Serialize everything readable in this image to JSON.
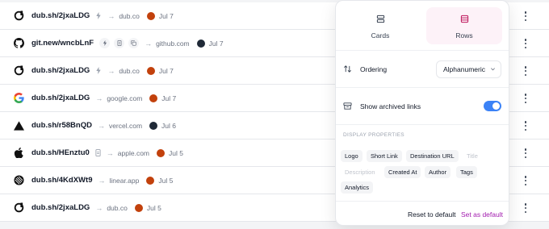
{
  "links": [
    {
      "logo": "dub-logo-icon",
      "short_link": "dub.sh/2jxaLDG",
      "chips": [
        "bolt-icon"
      ],
      "destination": "dub.co",
      "date": "Jul 7",
      "avatar_color": "#c2410c"
    },
    {
      "logo": "github-logo-icon",
      "short_link": "git.new/wncbLnF",
      "chips": [
        "bolt-icon",
        "file-icon",
        "copy-icon"
      ],
      "destination": "github.com",
      "date": "Jul 7",
      "avatar_color": "#1f2937"
    },
    {
      "logo": "dub-logo-icon",
      "short_link": "dub.sh/2jxaLDG",
      "chips": [
        "bolt-icon"
      ],
      "destination": "dub.co",
      "date": "Jul 7",
      "avatar_color": "#c2410c"
    },
    {
      "logo": "google-logo-icon",
      "short_link": "dub.sh/2jxaLDG",
      "chips": [],
      "destination": "google.com",
      "date": "Jul 7",
      "avatar_color": "#c2410c"
    },
    {
      "logo": "vercel-logo-icon",
      "short_link": "dub.sh/r58BnQD",
      "chips": [],
      "destination": "vercel.com",
      "date": "Jul 6",
      "avatar_color": "#1f2937"
    },
    {
      "logo": "apple-logo-icon",
      "short_link": "dub.sh/HEnztu0",
      "chips": [
        "file-icon"
      ],
      "destination": "apple.com",
      "date": "Jul 5",
      "avatar_color": "#c2410c"
    },
    {
      "logo": "linear-logo-icon",
      "short_link": "dub.sh/4KdXWt9",
      "chips": [],
      "destination": "linear.app",
      "date": "Jul 5",
      "avatar_color": "#c2410c"
    },
    {
      "logo": "dub-logo-icon",
      "short_link": "dub.sh/2jxaLDG",
      "chips": [],
      "destination": "dub.co",
      "date": "Jul 5",
      "avatar_color": "#c2410c"
    }
  ],
  "panel": {
    "views": {
      "cards": "Cards",
      "rows": "Rows",
      "selected": "Rows"
    },
    "ordering": {
      "label": "Ordering",
      "value": "Alphanumeric"
    },
    "archived": {
      "label": "Show archived links",
      "enabled": true
    },
    "display_properties": {
      "title": "DISPLAY PROPERTIES",
      "items": [
        {
          "label": "Logo",
          "active": true
        },
        {
          "label": "Short Link",
          "active": true
        },
        {
          "label": "Destination URL",
          "active": true
        },
        {
          "label": "Title",
          "active": false
        },
        {
          "label": "Description",
          "active": false
        },
        {
          "label": "Created At",
          "active": true
        },
        {
          "label": "Author",
          "active": true
        },
        {
          "label": "Tags",
          "active": true
        },
        {
          "label": "Analytics",
          "active": true
        }
      ]
    },
    "footer": {
      "reset": "Reset to default",
      "set_default": "Set as default"
    }
  },
  "colors": {
    "accent_pink": "#a21caf",
    "toggle_blue": "#3b82f6",
    "rows_bg": "#fdf2f8"
  }
}
